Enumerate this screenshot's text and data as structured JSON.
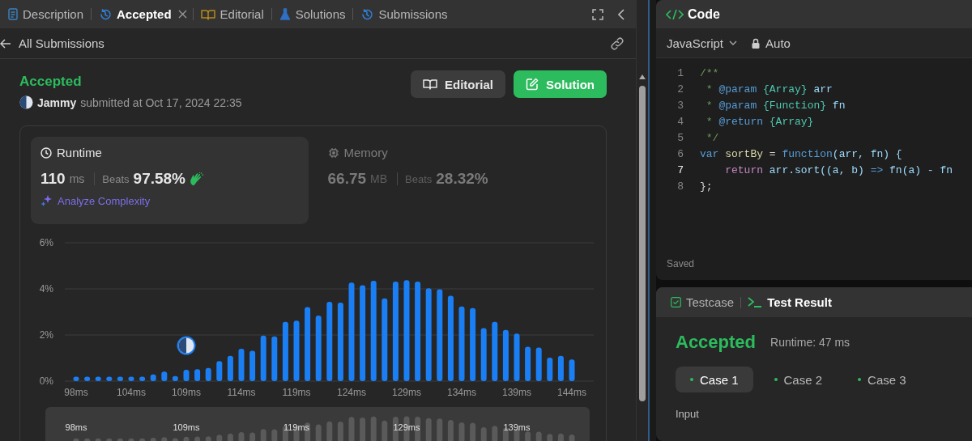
{
  "left_tabs": [
    {
      "label": "Description",
      "kind": "description",
      "selected": false,
      "closable": false
    },
    {
      "label": "Accepted",
      "kind": "history",
      "selected": true,
      "closable": true
    },
    {
      "label": "Editorial",
      "kind": "book",
      "selected": false,
      "closable": false
    },
    {
      "label": "Solutions",
      "kind": "flask",
      "selected": false,
      "closable": false
    },
    {
      "label": "Submissions",
      "kind": "history",
      "selected": false,
      "closable": false
    }
  ],
  "back_link": {
    "label": "All Submissions"
  },
  "submission": {
    "status": "Accepted",
    "user": "Jammy",
    "submitted_text": "submitted at Oct 17, 2024 22:35"
  },
  "buttons": [
    {
      "label": "Editorial",
      "kind": "secondary"
    },
    {
      "label": "Solution",
      "kind": "primary"
    }
  ],
  "stats": [
    {
      "title": "Runtime",
      "kind": "runtime",
      "selected": true,
      "value": "110",
      "unit": "ms",
      "beats_label": "Beats",
      "beats": "97.58%",
      "celebrated": true
    },
    {
      "title": "Memory",
      "kind": "memory",
      "selected": false,
      "value": "66.75",
      "unit": "MB",
      "beats_label": "Beats",
      "beats": "28.32%",
      "celebrated": false
    }
  ],
  "analyze_link": "Analyze Complexity",
  "chart_data": {
    "type": "bar",
    "ylim": [
      0,
      6
    ],
    "yticks": [
      {
        "value": 0,
        "label": "0%"
      },
      {
        "value": 2,
        "label": "2%"
      },
      {
        "value": 4,
        "label": "4%"
      },
      {
        "value": 6,
        "label": "6%"
      }
    ],
    "categories": [
      "98ms",
      null,
      null,
      null,
      null,
      "104ms",
      null,
      null,
      null,
      null,
      "109ms",
      null,
      null,
      null,
      null,
      "114ms",
      null,
      null,
      null,
      null,
      "119ms",
      null,
      null,
      null,
      null,
      "124ms",
      null,
      null,
      null,
      null,
      "129ms",
      null,
      null,
      null,
      null,
      "134ms",
      null,
      null,
      null,
      null,
      "139ms",
      null,
      null,
      null,
      null,
      "144ms"
    ],
    "values": [
      0.19,
      0.19,
      0.19,
      0.19,
      0.19,
      0.19,
      0.19,
      0.29,
      0.41,
      0.22,
      0.49,
      0.52,
      0.57,
      0.87,
      1.1,
      1.4,
      1.32,
      1.97,
      1.94,
      2.57,
      2.62,
      3.21,
      2.84,
      3.44,
      3.4,
      4.27,
      4.16,
      4.35,
      3.59,
      4.32,
      4.38,
      4.32,
      4.03,
      3.98,
      3.7,
      3.24,
      3.17,
      2.3,
      2.57,
      2.22,
      2.06,
      1.49,
      1.46,
      1.02,
      1.1,
      0.94
    ],
    "annotations": [
      {
        "x": "109ms"
      }
    ]
  },
  "overview_labels": [
    "98ms",
    "109ms",
    "119ms",
    "129ms",
    "139ms"
  ],
  "code_panel": {
    "title": "Code",
    "language": "JavaScript",
    "mode": "Auto",
    "status": "Saved",
    "lines": [
      {
        "number": "1",
        "current": false,
        "tokens": [
          {
            "text": "/**",
            "kind": "comment"
          }
        ]
      },
      {
        "number": "2",
        "current": false,
        "tokens": [
          {
            "text": " * ",
            "kind": "comment"
          },
          {
            "text": "@param",
            "kind": "tag"
          },
          {
            "text": " {Array}",
            "kind": "type"
          },
          {
            "text": " arr",
            "kind": "name"
          }
        ]
      },
      {
        "number": "3",
        "current": false,
        "tokens": [
          {
            "text": " * ",
            "kind": "comment"
          },
          {
            "text": "@param",
            "kind": "tag"
          },
          {
            "text": " {Function}",
            "kind": "type"
          },
          {
            "text": " fn",
            "kind": "name"
          }
        ]
      },
      {
        "number": "4",
        "current": false,
        "tokens": [
          {
            "text": " * ",
            "kind": "comment"
          },
          {
            "text": "@return",
            "kind": "tag"
          },
          {
            "text": " {Array}",
            "kind": "type"
          }
        ]
      },
      {
        "number": "5",
        "current": false,
        "tokens": [
          {
            "text": " */",
            "kind": "comment"
          }
        ]
      },
      {
        "number": "6",
        "current": false,
        "tokens": [
          {
            "text": "var",
            "kind": "keyword"
          },
          {
            "text": " sortBy ",
            "kind": "fn"
          },
          {
            "text": "= ",
            "kind": "plain"
          },
          {
            "text": "function",
            "kind": "keyword"
          },
          {
            "text": "(arr, fn) {",
            "kind": "name"
          }
        ]
      },
      {
        "number": "7",
        "current": true,
        "tokens": [
          {
            "text": "    return",
            "kind": "control"
          },
          {
            "text": " arr.sort((a, b) ",
            "kind": "name"
          },
          {
            "text": "=>",
            "kind": "keyword"
          },
          {
            "text": " fn(a) - fn",
            "kind": "name"
          }
        ]
      },
      {
        "number": "8",
        "current": false,
        "tokens": [
          {
            "text": "};",
            "kind": "plain"
          }
        ]
      }
    ]
  },
  "result_panel": {
    "tabs": [
      {
        "label": "Testcase",
        "kind": "testcase",
        "selected": false
      },
      {
        "label": "Test Result",
        "kind": "result",
        "selected": true
      }
    ],
    "status": "Accepted",
    "runtime": "Runtime: 47 ms",
    "cases": [
      {
        "label": "Case 1",
        "selected": true
      },
      {
        "label": "Case 2",
        "selected": false
      },
      {
        "label": "Case 3",
        "selected": false
      }
    ],
    "input_label": "Input"
  }
}
